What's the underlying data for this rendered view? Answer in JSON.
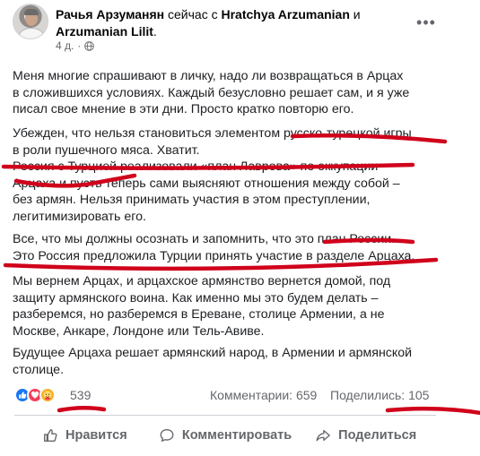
{
  "post": {
    "author": "Рачья Арзуманян",
    "action_text": "сейчас с",
    "tagged": [
      "Hratchya Arzumanian",
      "Arzumanian Lilit"
    ],
    "and_word": "и",
    "period": ".",
    "time": "4 д.",
    "more_icon": "more-horizontal-icon",
    "paragraphs": [
      [
        "Меня многие спрашивают в личку, надо ли возвращаться в Арцах",
        "в сложившихся условиях. Каждый безусловно решает сам, и я уже",
        "писал свое мнение в эти дни. Просто кратко повторю его."
      ],
      [
        "Убежден, что нельзя становиться элементом русско-турецкой игры",
        "в роли пушечного мяса. Хватит."
      ],
      [
        "Россия с Турцией реализовали «план Лаврова» по оккупации",
        "Арцаха и пусть теперь сами выясняют отношения между собой –",
        "без армян. Нельзя принимать участия в этом преступлении,",
        "легитимизировать его."
      ],
      [
        "Все, что мы должны осознать и запомнить, что это план России.",
        "Это Россия предложила Турции принять участие в разделе Арцаха."
      ],
      [
        "Мы вернем Арцах, и арцахское армянство вернется домой, под",
        "защиту армянского воина. Как именно мы это будем делать –",
        "разберемся, но разберемся в Ереване, столице Армении, а не",
        "Москве, Анкаре, Лондоне или Тель-Авиве."
      ],
      [
        "Будущее Арцаха решает армянский народ, в Армении и армянской",
        "столице."
      ]
    ]
  },
  "stats": {
    "reactions": "539",
    "reaction_icons": [
      "like-icon",
      "love-icon",
      "care-icon"
    ],
    "comments": "Комментарии: 659",
    "shares": "Поделились: 105"
  },
  "actions": {
    "like": "Нравится",
    "comment": "Комментировать",
    "share": "Поделиться"
  },
  "colors": {
    "marker": "#d0021b",
    "like": "#1877f2",
    "love": "#f33e58",
    "care": "#f7b125",
    "secondary_text": "#65676b"
  }
}
